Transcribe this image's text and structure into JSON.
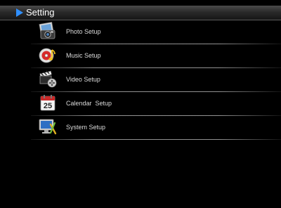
{
  "header": {
    "title": "Setting",
    "arrow_icon": "play-arrow-icon",
    "accent": "#2f8fff"
  },
  "menu": {
    "items": [
      {
        "label": "Photo Setup",
        "icon": "photo-icon"
      },
      {
        "label": "Music Setup",
        "icon": "music-icon"
      },
      {
        "label": "Video Setup",
        "icon": "video-icon"
      },
      {
        "label": "Calendar  Setup",
        "icon": "calendar-icon",
        "icon_text": "25"
      },
      {
        "label": "System Setup",
        "icon": "system-icon"
      }
    ]
  }
}
